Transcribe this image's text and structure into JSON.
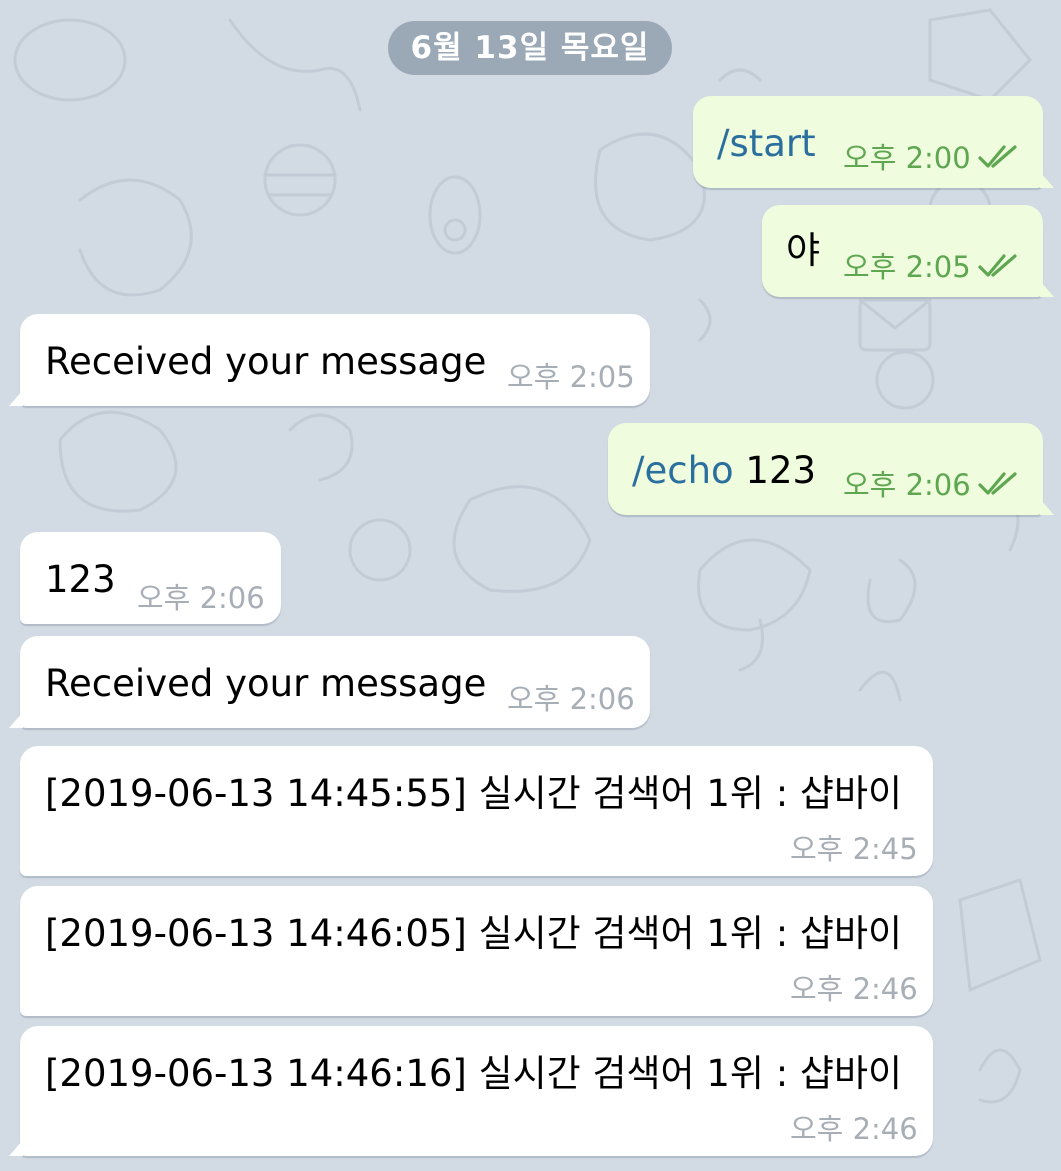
{
  "date_header": "6월 13일 목요일",
  "messages": [
    {
      "dir": "out",
      "command": "/start",
      "text": "",
      "time": "오후 2:00",
      "read_icon": "double-check-icon"
    },
    {
      "dir": "out",
      "command": "",
      "text": "야",
      "time": "오후 2:05",
      "read_icon": "double-check-icon"
    },
    {
      "dir": "in",
      "command": "",
      "text": "Received your message",
      "time": "오후 2:05"
    },
    {
      "dir": "out",
      "command": "/echo",
      "text": " 123",
      "time": "오후 2:06",
      "read_icon": "double-check-icon"
    },
    {
      "dir": "in",
      "command": "",
      "text": "123",
      "time": "오후 2:06"
    },
    {
      "dir": "in",
      "command": "",
      "text": "Received your message",
      "time": "오후 2:06"
    },
    {
      "dir": "in",
      "command": "",
      "text": "[2019-06-13 14:45:55] 실시간 검색어 1위 : 샵바이",
      "time": "오후 2:45"
    },
    {
      "dir": "in",
      "command": "",
      "text": "[2019-06-13 14:46:05] 실시간 검색어 1위 : 샵바이",
      "time": "오후 2:46"
    },
    {
      "dir": "in",
      "command": "",
      "text": "[2019-06-13 14:46:16] 실시간 검색어 1위 : 샵바이",
      "time": "오후 2:46"
    }
  ],
  "colors": {
    "background": "#d2dae3",
    "outgoing_bubble": "#effdde",
    "incoming_bubble": "#ffffff",
    "command_link": "#2b6f9e",
    "outgoing_time": "#5fa651",
    "incoming_time": "#a7aeb6"
  }
}
